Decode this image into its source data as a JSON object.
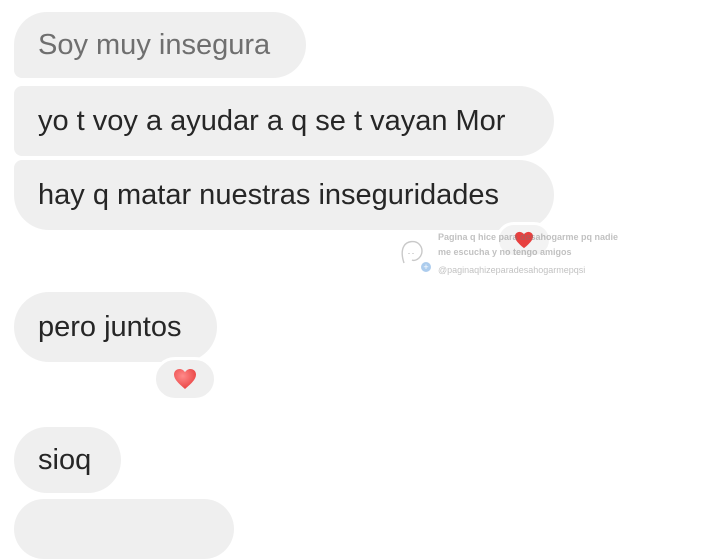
{
  "messages": [
    {
      "text": "Soy muy insegura"
    },
    {
      "text": "yo t voy a ayudar a q se t vayan Mor"
    },
    {
      "text": "hay q matar nuestras inseguridades"
    },
    {
      "text": "pero juntos"
    },
    {
      "text": "sioq"
    }
  ],
  "reactions": {
    "small": {
      "icon": "heart-icon",
      "color": "#e8403f"
    },
    "main": {
      "icon": "heart-icon",
      "color": "#e8403f"
    }
  },
  "watermark": {
    "line1": "Pagina q hice para desahogarme pq nadie",
    "line2": "me escucha y no tengo amigos",
    "handle": "@paginaqhizeparadesahogarmepqsi"
  },
  "colors": {
    "bubble_bg": "#efefef",
    "text": "#262626",
    "muted_text": "#6f6f6f"
  }
}
